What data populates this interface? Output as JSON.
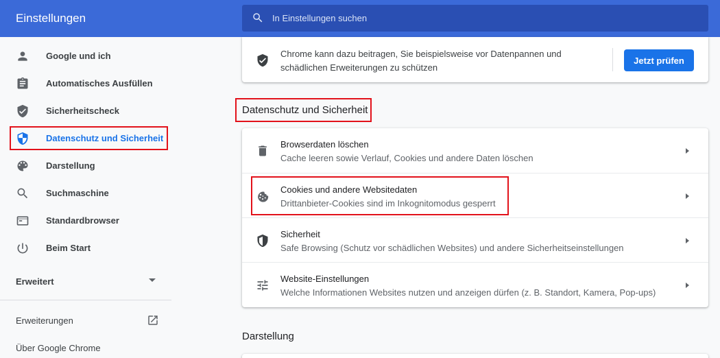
{
  "header": {
    "title": "Einstellungen",
    "search_placeholder": "In Einstellungen suchen"
  },
  "sidebar": {
    "items": [
      {
        "label": "Google und ich",
        "icon": "person-icon"
      },
      {
        "label": "Automatisches Ausfüllen",
        "icon": "clipboard-icon"
      },
      {
        "label": "Sicherheitscheck",
        "icon": "shield-check-icon"
      },
      {
        "label": "Datenschutz und Sicherheit",
        "icon": "shield-privacy-icon",
        "active": true
      },
      {
        "label": "Darstellung",
        "icon": "palette-icon"
      },
      {
        "label": "Suchmaschine",
        "icon": "search-icon"
      },
      {
        "label": "Standardbrowser",
        "icon": "browser-window-icon"
      },
      {
        "label": "Beim Start",
        "icon": "power-icon"
      }
    ],
    "advanced_label": "Erweitert",
    "extensions_label": "Erweiterungen",
    "about_label": "Über Google Chrome"
  },
  "safety_check": {
    "text": "Chrome kann dazu beitragen, Sie beispielsweise vor Datenpannen und schädlichen Erweiterungen zu schützen",
    "button_label": "Jetzt prüfen"
  },
  "privacy_section": {
    "title": "Datenschutz und Sicherheit",
    "rows": [
      {
        "title": "Browserdaten löschen",
        "subtitle": "Cache leeren sowie Verlauf, Cookies und andere Daten löschen",
        "icon": "trash-icon"
      },
      {
        "title": "Cookies und andere Websitedaten",
        "subtitle": "Drittanbieter-Cookies sind im Inkognitomodus gesperrt",
        "icon": "cookie-icon"
      },
      {
        "title": "Sicherheit",
        "subtitle": "Safe Browsing (Schutz vor schädlichen Websites) und andere Sicherheitseinstellungen",
        "icon": "shield-half-icon"
      },
      {
        "title": "Website-Einstellungen",
        "subtitle": "Welche Informationen Websites nutzen und anzeigen dürfen (z. B. Standort, Kamera, Pop-ups)",
        "icon": "tune-icon"
      }
    ]
  },
  "appearance_section": {
    "title": "Darstellung"
  },
  "colors": {
    "header_bg": "#3b6ad8",
    "search_bg": "#2a4fb3",
    "accent": "#1a73e8",
    "highlight": "#e2111a"
  }
}
